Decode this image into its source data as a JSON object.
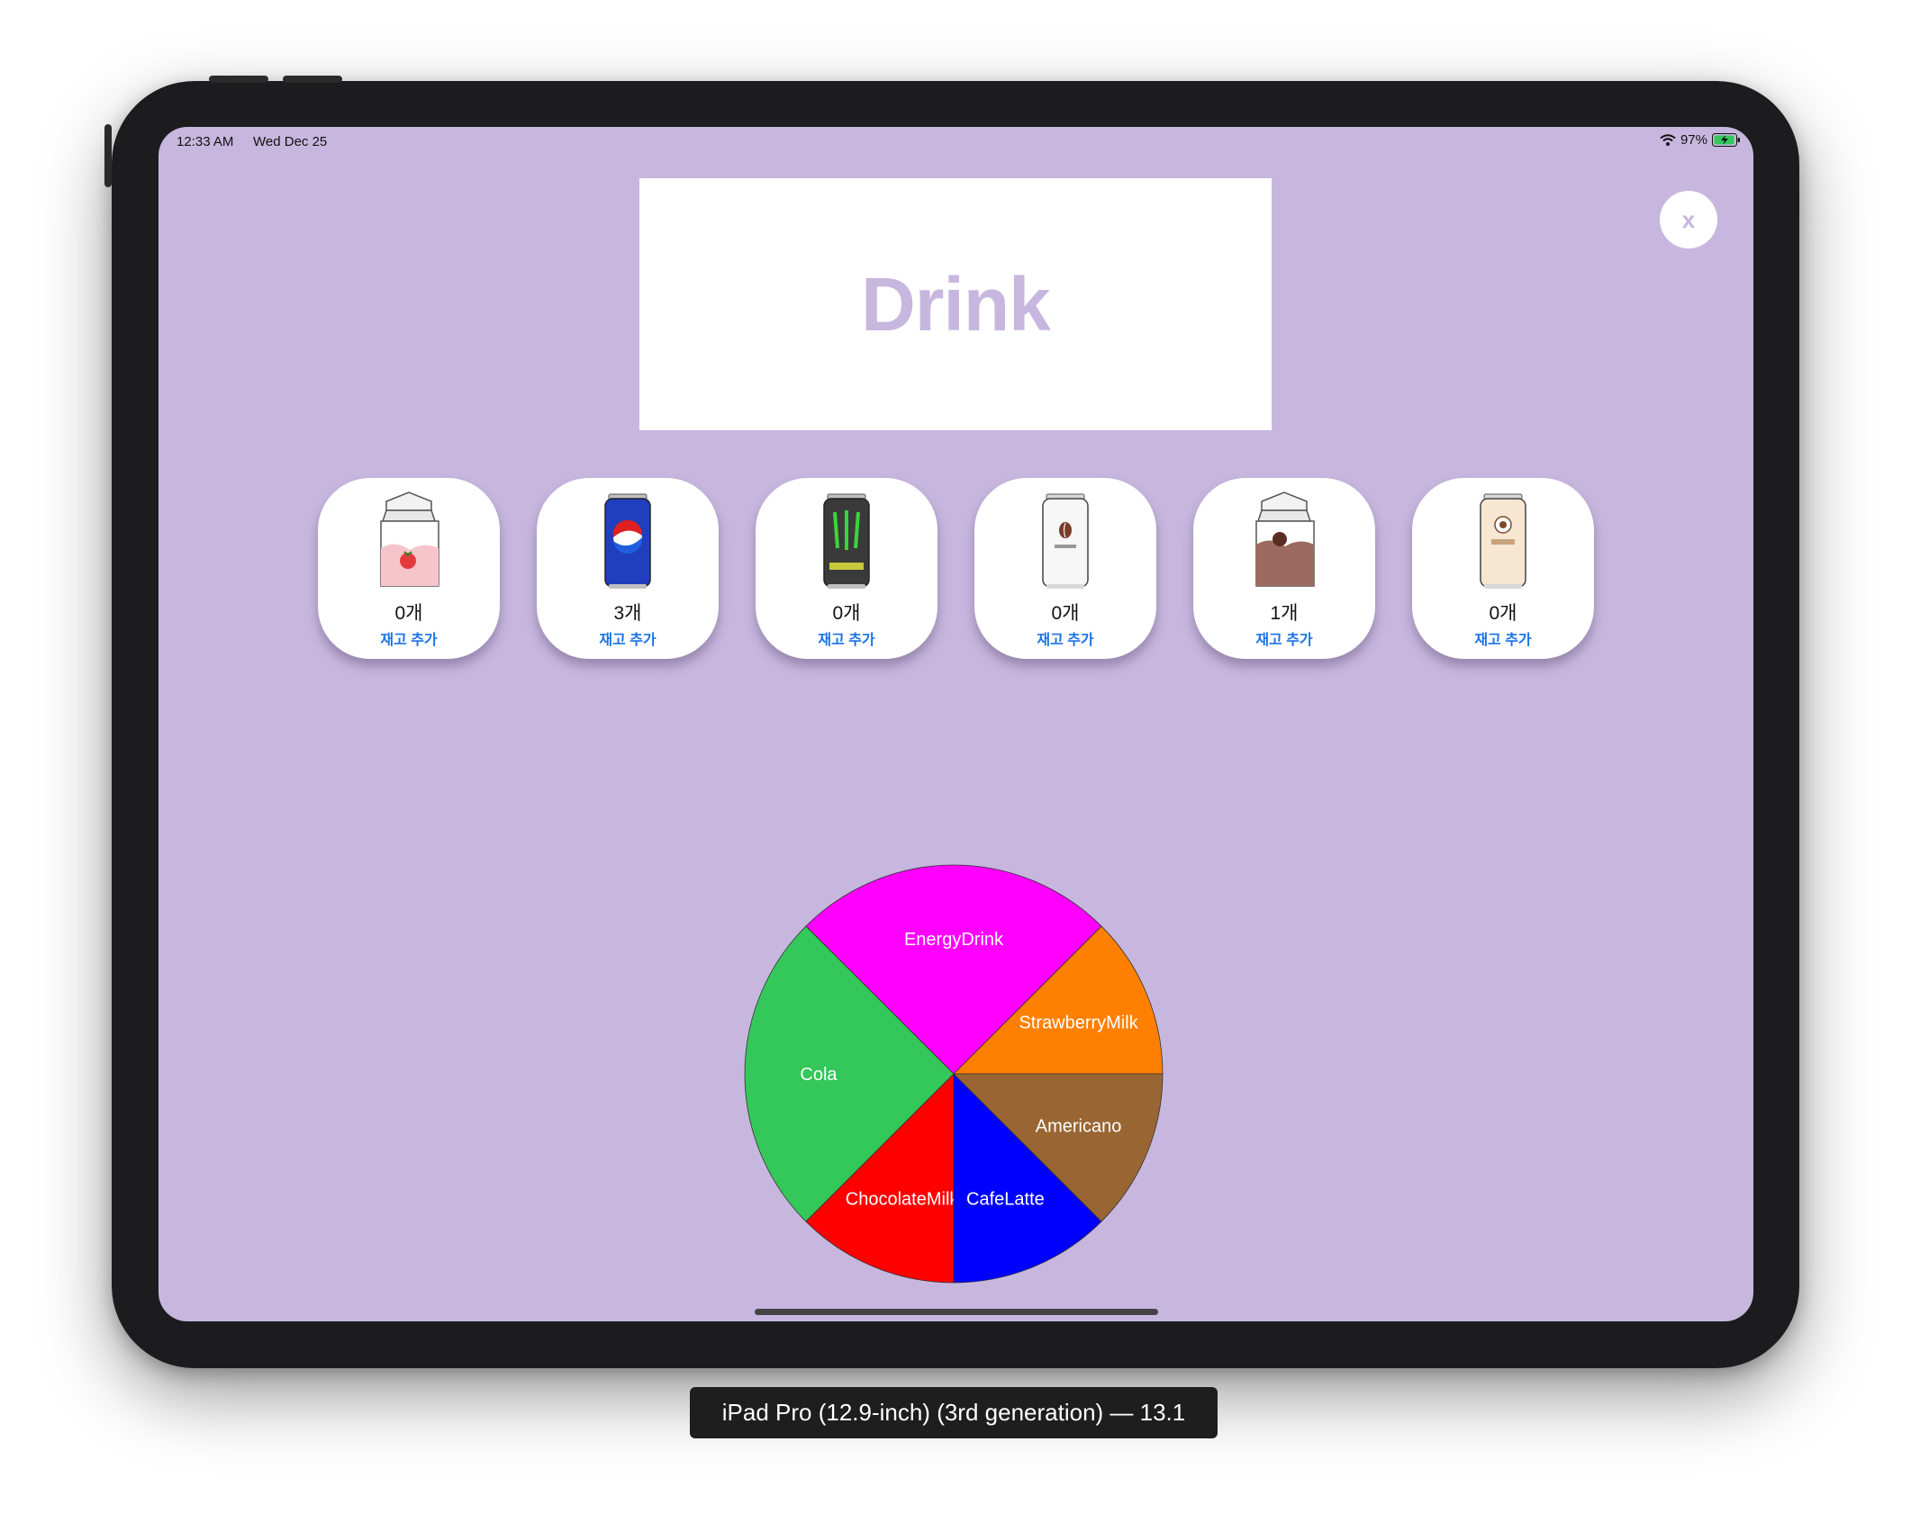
{
  "colors": {
    "screen_bg": "#c7b7df",
    "title_color": "#c7b7df",
    "link_blue": "#1a73e8",
    "close_color": "#c7b7df"
  },
  "status_bar": {
    "time": "12:33 AM",
    "date": "Wed Dec 25",
    "battery_pct": "97%",
    "icons": [
      "wifi-icon",
      "battery-charging-icon"
    ]
  },
  "header": {
    "title": "Drink"
  },
  "close_button": {
    "label": "x"
  },
  "items": [
    {
      "name": "strawberry-milk",
      "icon": "strawberry-milk-carton-icon",
      "count": "0개",
      "action": "재고 추가"
    },
    {
      "name": "cola",
      "icon": "cola-can-icon",
      "count": "3개",
      "action": "재고 추가"
    },
    {
      "name": "energy-drink",
      "icon": "energy-drink-can-icon",
      "count": "0개",
      "action": "재고 추가"
    },
    {
      "name": "americano",
      "icon": "coffee-can-icon",
      "count": "0개",
      "action": "재고 추가"
    },
    {
      "name": "chocolate-milk",
      "icon": "chocolate-milk-carton-icon",
      "count": "1개",
      "action": "재고 추가"
    },
    {
      "name": "cafe-latte",
      "icon": "latte-can-icon",
      "count": "0개",
      "action": "재고 추가"
    }
  ],
  "chart_data": {
    "type": "pie",
    "start_angle_deg": 0,
    "direction": "counterclockwise",
    "slices": [
      {
        "label": "StrawberryMilk",
        "value": 12.5,
        "color": "#ff8000"
      },
      {
        "label": "EnergyDrink",
        "value": 25,
        "color": "#ff00ff"
      },
      {
        "label": "Cola",
        "value": 25,
        "color": "#34c759"
      },
      {
        "label": "ChocolateMilk",
        "value": 12.5,
        "color": "#ff0000"
      },
      {
        "label": "CafeLatte",
        "value": 12.5,
        "color": "#0000ff"
      },
      {
        "label": "Americano",
        "value": 12.5,
        "color": "#996633"
      }
    ]
  },
  "device_label": "iPad Pro (12.9-inch) (3rd generation) — 13.1"
}
